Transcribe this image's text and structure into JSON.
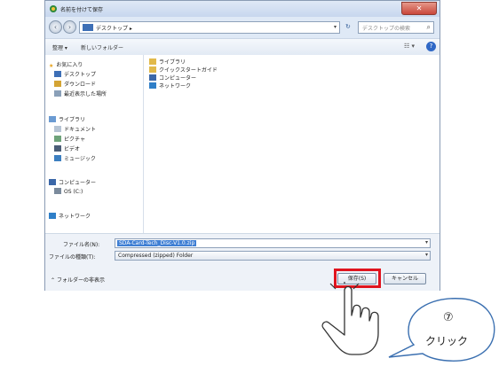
{
  "window": {
    "title": "名前を付けて保存",
    "close_label": "✕"
  },
  "address_bar": {
    "path": "デスクトップ ▸",
    "search_placeholder": "デスクトップの検索"
  },
  "toolbar": {
    "organize": "整理 ▾",
    "new_folder": "新しいフォルダー",
    "view": "☷ ▾",
    "help": "?"
  },
  "nav_pane": {
    "favorites_header": "お気に入り",
    "favorites": [
      "デスクトップ",
      "ダウンロード",
      "最近表示した場所"
    ],
    "libraries_header": "ライブラリ",
    "libraries": [
      "ドキュメント",
      "ピクチャ",
      "ビデオ",
      "ミュージック"
    ],
    "computer_header": "コンピューター",
    "computer": [
      "OS (C:)"
    ],
    "network_header": "ネットワーク"
  },
  "content_items": [
    "ライブラリ",
    "クイックスタートガイド",
    "コンピューター",
    "ネットワーク"
  ],
  "form": {
    "filename_label": "ファイル名(N):",
    "filename_value": "SDA-Card-Tech_Disc-V1.0.zip",
    "filetype_label": "ファイルの種類(T):",
    "filetype_value": "Compressed (zipped) Folder",
    "hide_folders": "フォルダーの非表示"
  },
  "buttons": {
    "save": "保存(S)",
    "cancel": "キャンセル"
  },
  "annotation": {
    "step_number": "⑦",
    "step_label": "クリック",
    "highlight_color": "#e0141e"
  }
}
